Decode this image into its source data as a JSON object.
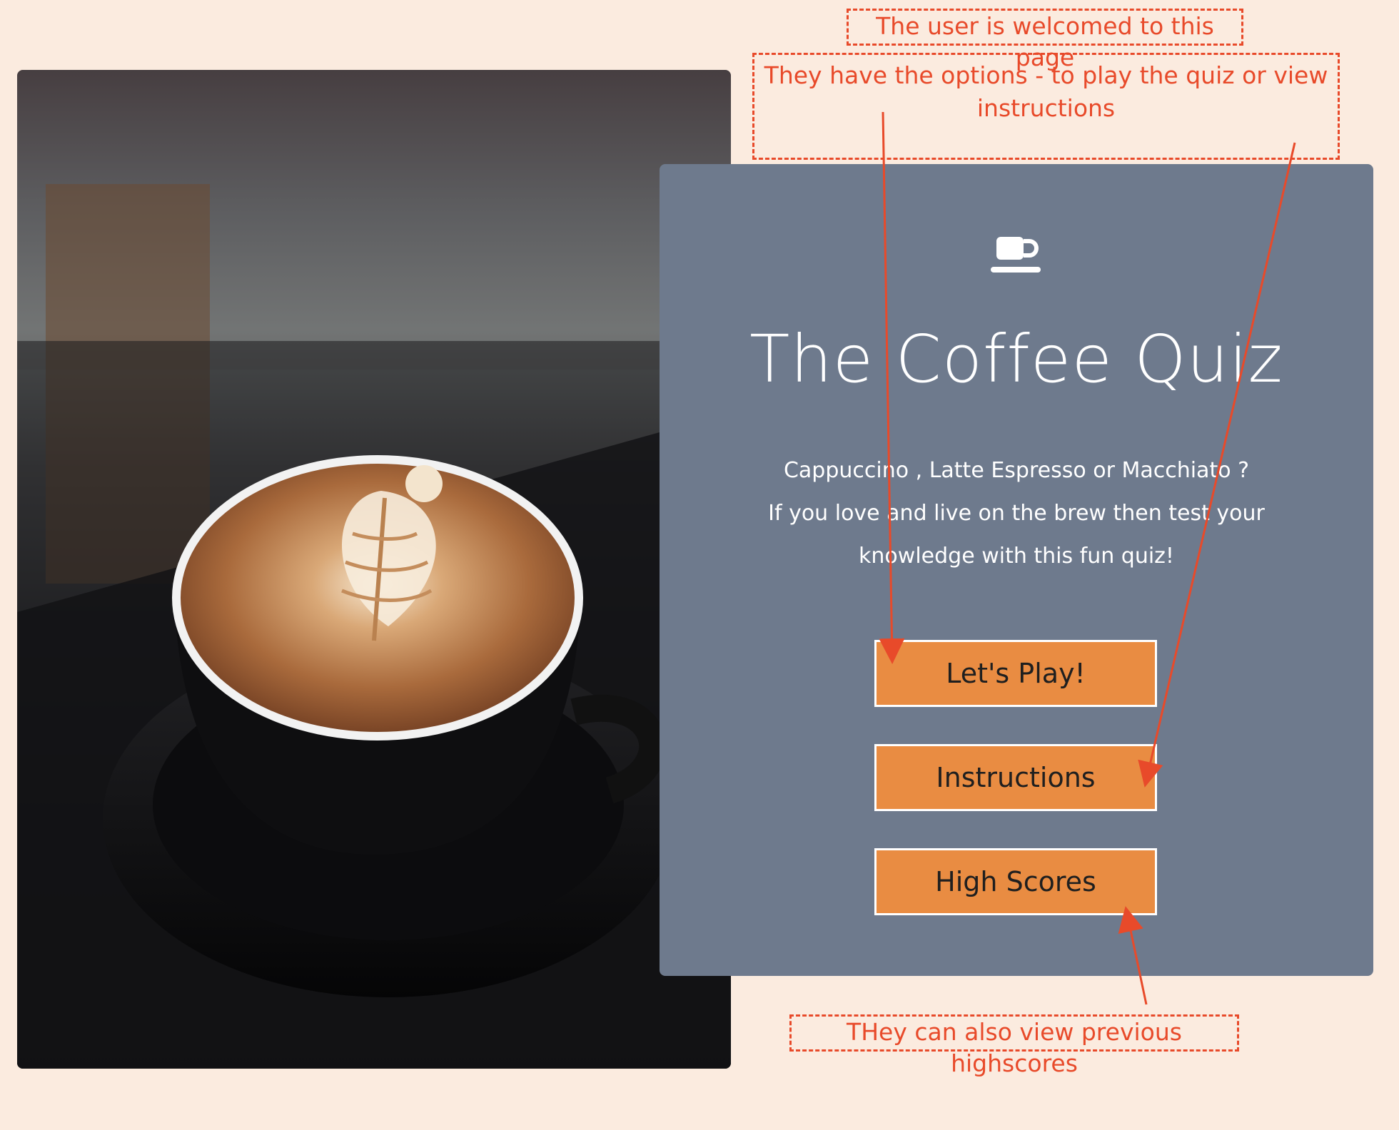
{
  "quiz_card": {
    "icon": "coffee-cup-icon",
    "title": "The Coffee Quiz",
    "tagline_lines": [
      "Cappuccino , Latte Espresso or Macchiato ?",
      "If you love and live on the brew then test your",
      "knowledge with this fun quiz!"
    ],
    "buttons": {
      "play": "Let's Play!",
      "instructions": "Instructions",
      "high_scores": "High Scores"
    }
  },
  "annotations": {
    "welcome": "The user is welcomed to this page",
    "options": "They have the options - to play the quiz or view instructions",
    "highscores": "THey can also view previous highscores"
  },
  "colors": {
    "background": "#fbebdf",
    "card": "#6e7a8d",
    "button": "#e98c42",
    "annotation": "#e84a2a"
  }
}
